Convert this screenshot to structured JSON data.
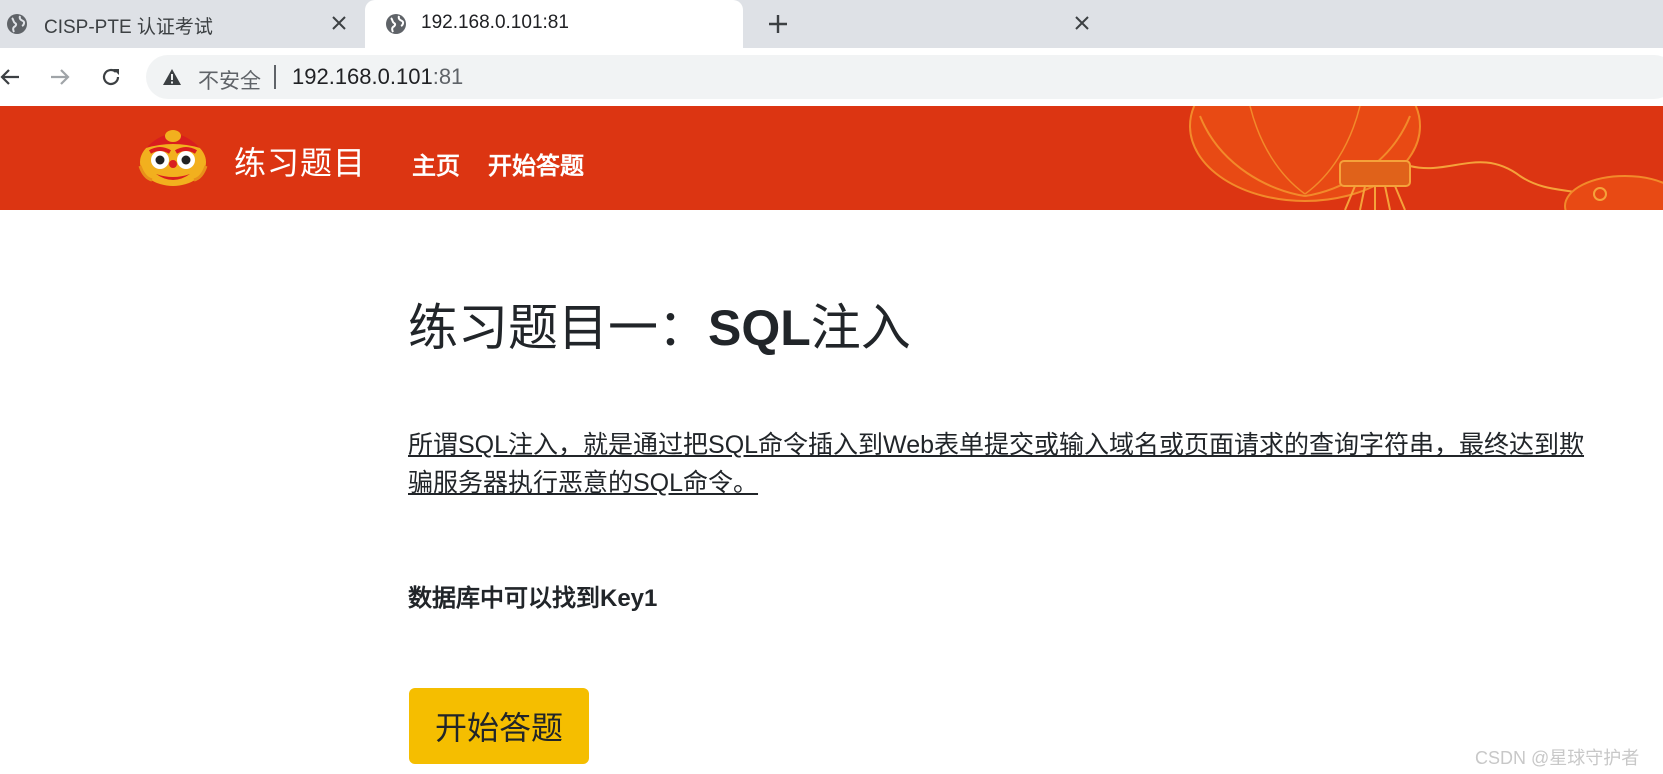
{
  "browser": {
    "tabs": [
      {
        "title": "CISP-PTE 认证考试",
        "active": false
      },
      {
        "title": "192.168.0.101:81",
        "active": true
      }
    ],
    "address_bar": {
      "security_label": "不安全",
      "host": "192.168.0.101",
      "port": ":81"
    }
  },
  "site": {
    "title": "练习题目",
    "nav": [
      "主页",
      "开始答题"
    ],
    "colors": {
      "header": "#dc3512",
      "button": "#f5be00"
    }
  },
  "content": {
    "heading_prefix": "练习题目一：",
    "heading_sql": "SQL",
    "heading_suffix": "注入",
    "intro": "所谓SQL注入，就是通过把SQL命令插入到Web表单提交或输入域名或页面请求的查询字符串，最终达到欺骗服务器执行恶意的SQL命令。",
    "hint": "数据库中可以找到Key1",
    "start_button": "开始答题"
  },
  "watermark": "CSDN @星球守护者"
}
